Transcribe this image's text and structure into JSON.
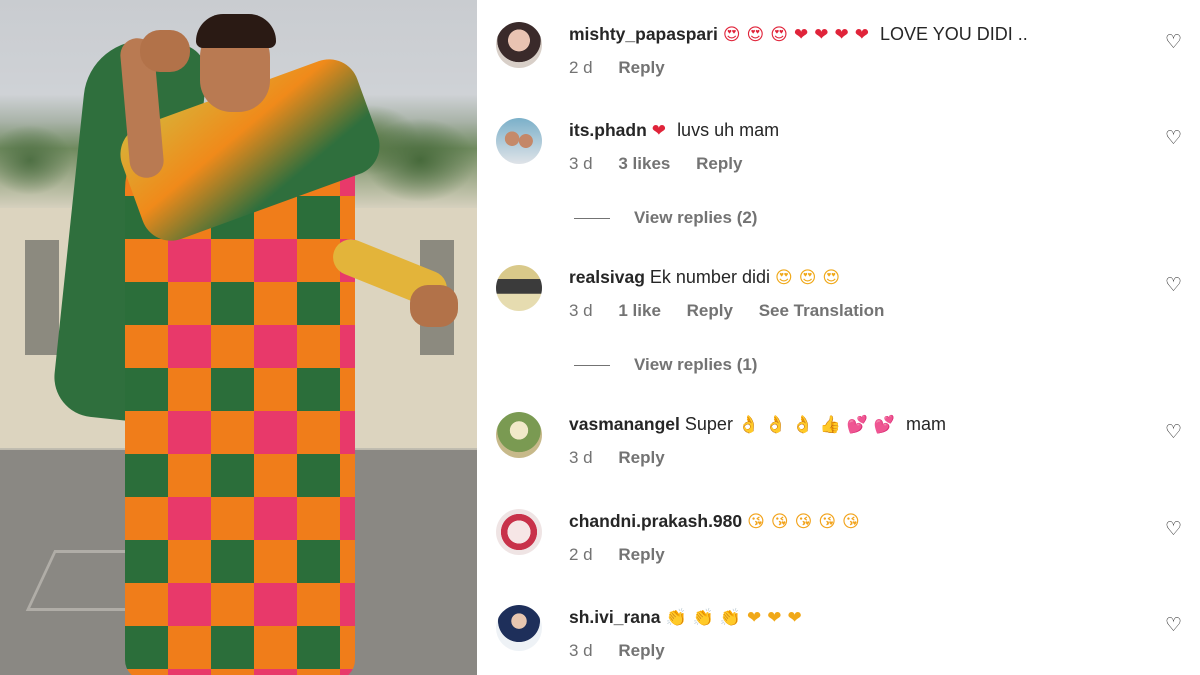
{
  "comments": [
    {
      "username": "mishty_papaspari",
      "text": "LOVE YOU DIDI ..",
      "emoji_before": "😍😍😍❤❤❤❤",
      "age": "2 d",
      "likes": "",
      "reply": "Reply",
      "translation": ""
    },
    {
      "username": "its.phadn",
      "emoji_before": "❤",
      "text": "luvs uh mam",
      "age": "3 d",
      "likes": "3 likes",
      "reply": "Reply",
      "translation": ""
    },
    {
      "username": "realsivag",
      "text": "Ek number didi",
      "emoji_after": "😍😍😍",
      "age": "3 d",
      "likes": "1 like",
      "reply": "Reply",
      "translation": "See Translation"
    },
    {
      "username": "vasmanangel",
      "text": "Super",
      "emoji_after": "👌👌👌👍💕💕",
      "text2": "mam",
      "age": "3 d",
      "likes": "",
      "reply": "Reply",
      "translation": ""
    },
    {
      "username": "chandni.prakash.980",
      "emoji_after": "😘😘😘😘😘",
      "age": "2 d",
      "likes": "",
      "reply": "Reply",
      "translation": ""
    },
    {
      "username": "sh.ivi_rana",
      "emoji_after": "👏👏👏❤❤❤",
      "age": "3 d",
      "likes": "",
      "reply": "Reply",
      "translation": ""
    }
  ],
  "view_replies": [
    "View replies (2)",
    "View replies (1)"
  ],
  "icons": {
    "like": "heart-outline-icon"
  },
  "colors": {
    "username": "#262626",
    "meta": "#737373",
    "heart_red": "#e0243a"
  }
}
